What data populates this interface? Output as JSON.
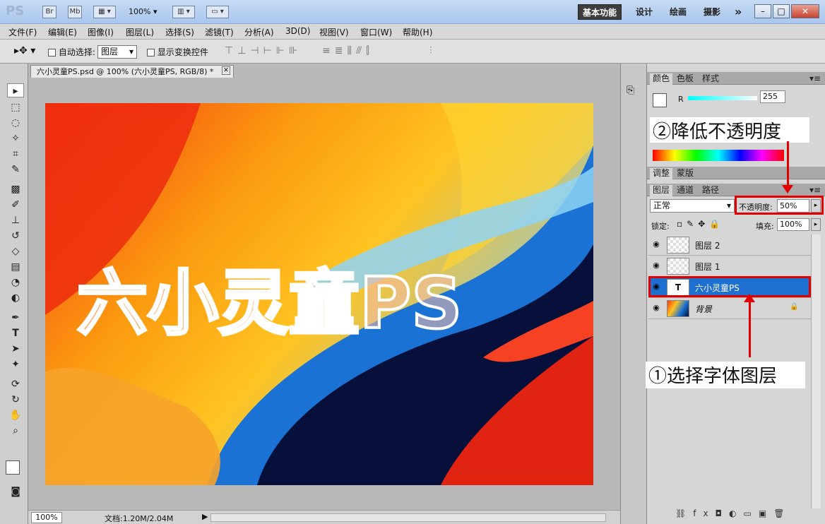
{
  "app": {
    "logo": "PS",
    "zoom": "100%"
  },
  "titlebar": {
    "icons": [
      "Br",
      "Mb"
    ],
    "workspaces": [
      "基本功能",
      "设计",
      "绘画",
      "摄影"
    ],
    "more": "»"
  },
  "menu": [
    "文件(F)",
    "编辑(E)",
    "图像(I)",
    "图层(L)",
    "选择(S)",
    "滤镜(T)",
    "分析(A)",
    "3D(D)",
    "视图(V)",
    "窗口(W)",
    "帮助(H)"
  ],
  "options": {
    "auto_select_label": "自动选择:",
    "auto_select_value": "图层",
    "show_transform_label": "显示变换控件"
  },
  "document": {
    "tab_title": "六小灵童PS.psd @ 100% (六小灵童PS, RGB/8) *",
    "canvas_text": "六小灵童PS"
  },
  "status": {
    "zoom": "100%",
    "doc_info": "文档:1.20M/2.04M"
  },
  "color_panel": {
    "tabs": [
      "颜色",
      "色板",
      "样式"
    ],
    "channel": "R",
    "value": "255"
  },
  "adjust_panel": {
    "tabs": [
      "调整",
      "蒙版"
    ]
  },
  "layers_panel": {
    "tabs": [
      "图层",
      "通道",
      "路径"
    ],
    "blend_mode": "正常",
    "opacity_label": "不透明度:",
    "opacity_value": "50%",
    "lock_label": "锁定:",
    "fill_label": "填充:",
    "fill_value": "100%",
    "layers": [
      {
        "name": "图层 2",
        "type": "pixel",
        "selected": false
      },
      {
        "name": "图层 1",
        "type": "pixel",
        "selected": false
      },
      {
        "name": "六小灵童PS",
        "type": "text",
        "selected": true
      },
      {
        "name": "背景",
        "type": "background",
        "selected": false
      }
    ]
  },
  "annotations": {
    "step1": "①选择字体图层",
    "step2": "②降低不透明度"
  },
  "colors": {
    "highlight": "#e00000",
    "selection": "#1d6fd0"
  }
}
